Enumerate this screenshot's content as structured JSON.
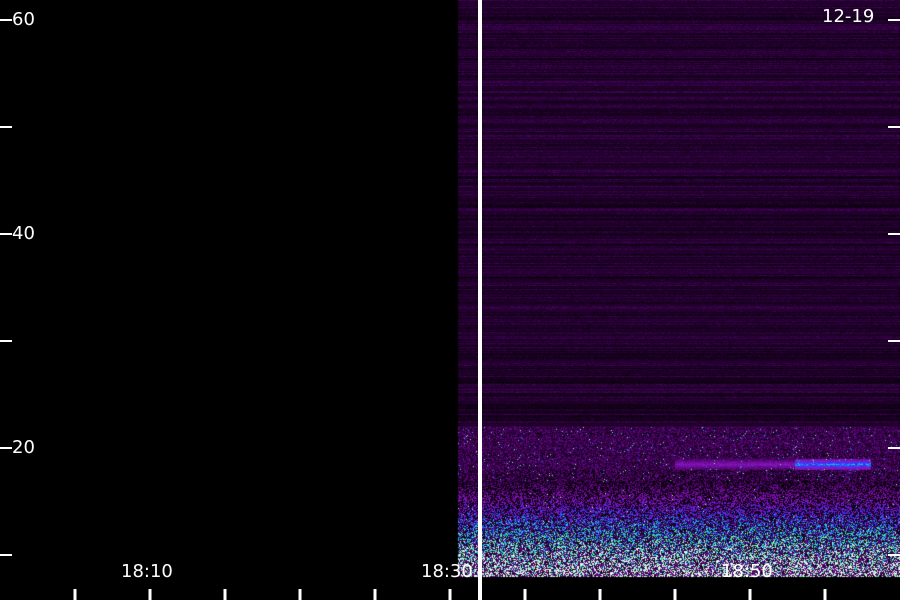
{
  "chart_data": {
    "type": "heatmap",
    "title": "",
    "date_label": "12-19",
    "xlabel": "",
    "ylabel": "",
    "x_tick_labels": [
      "18:10",
      "18:30",
      "18:50"
    ],
    "y_tick_labels": [
      "20",
      "40",
      "60"
    ],
    "y_ticks": [
      10,
      20,
      30,
      40,
      50,
      60
    ],
    "ylim": [
      10,
      62
    ],
    "xlim": [
      "18:00",
      "19:00"
    ],
    "data_start": "18:30",
    "marker_time": "18:32",
    "colormap": [
      "#000000",
      "#2a0038",
      "#6a0a90",
      "#8a18c8",
      "#2838ff",
      "#18c8e8",
      "#48f080",
      "#f8f8f8"
    ],
    "features": [
      {
        "kind": "background-speckle",
        "y_range": [
          22,
          62
        ],
        "intensity": 0.22
      },
      {
        "kind": "band",
        "y": 18.5,
        "x_range": [
          "18:53",
          "18:58"
        ],
        "intensity": 0.75
      },
      {
        "kind": "band",
        "y": 18.5,
        "x_range": [
          "18:45",
          "18:53"
        ],
        "intensity": 0.45
      },
      {
        "kind": "low-frequency-noise",
        "y_range": [
          10,
          17
        ],
        "intensity": 0.9
      }
    ]
  }
}
